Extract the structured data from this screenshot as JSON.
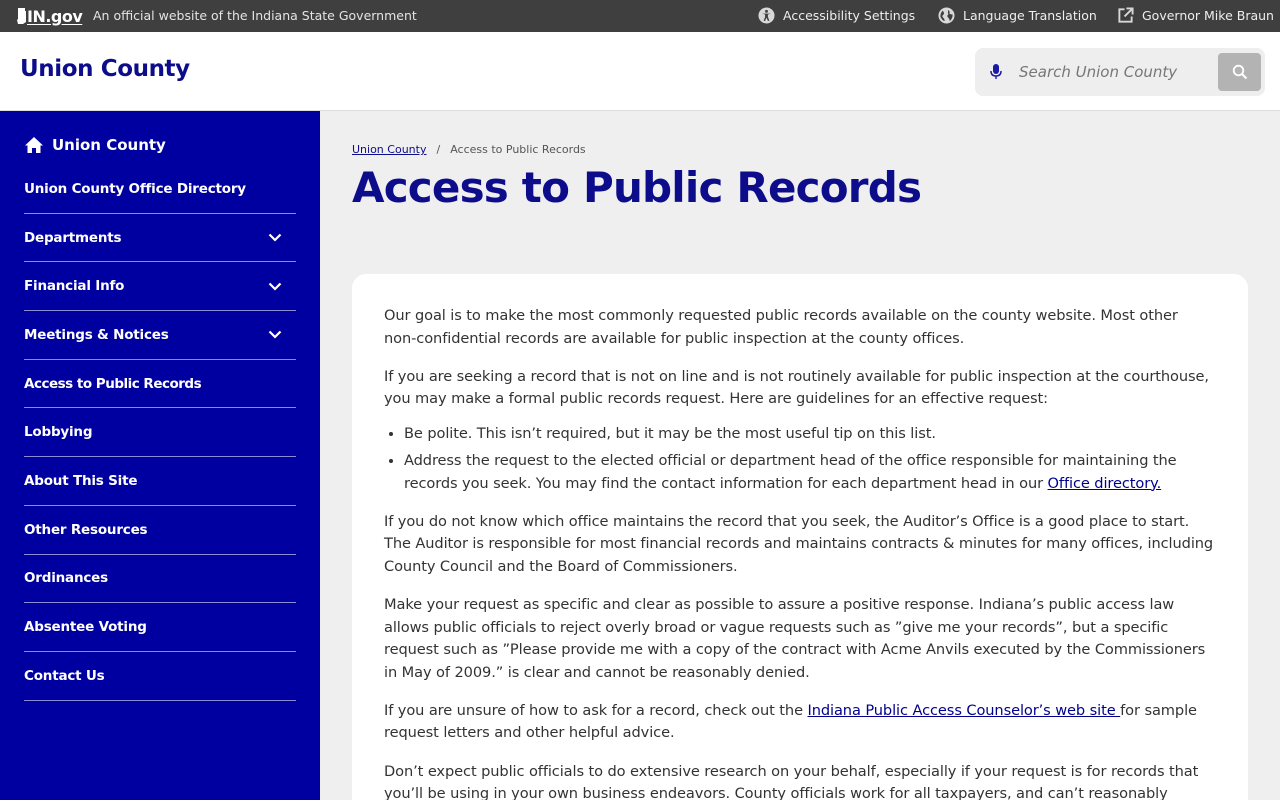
{
  "statebar": {
    "brand": "IN.gov",
    "official_text": "An official website of the Indiana State Government",
    "links": [
      {
        "label": "Accessibility Settings",
        "icon": "accessibility-icon"
      },
      {
        "label": "Language Translation",
        "icon": "globe-icon"
      },
      {
        "label": "Governor Mike Braun",
        "icon": "external-link-icon"
      }
    ]
  },
  "header": {
    "site_title": "Union County",
    "search_placeholder": "Search Union County"
  },
  "sidebar": {
    "home_label": "Union County",
    "items": [
      {
        "label": "Union County Office Directory",
        "expandable": false
      },
      {
        "label": "Departments",
        "expandable": true
      },
      {
        "label": "Financial Info",
        "expandable": true
      },
      {
        "label": "Meetings & Notices",
        "expandable": true
      },
      {
        "label": "Access to Public Records",
        "expandable": false,
        "active": true
      },
      {
        "label": "Lobbying",
        "expandable": false
      },
      {
        "label": "About This Site",
        "expandable": false
      },
      {
        "label": "Other Resources",
        "expandable": false
      },
      {
        "label": "Ordinances",
        "expandable": false
      },
      {
        "label": "Absentee Voting",
        "expandable": false
      },
      {
        "label": "Contact Us",
        "expandable": false
      }
    ]
  },
  "breadcrumb": {
    "home": "Union County",
    "separator": "/",
    "current": "Access to Public Records"
  },
  "page_title": "Access to Public Records",
  "content": {
    "p1": "Our goal is to make the most commonly requested public records available on the county website. Most other non-confidential records are available for public inspection at the county offices.",
    "p2": "If you are seeking a record that is not on line and is not routinely available for public inspection at the courthouse, you may make a formal public records request. Here are guidelines for an effective request:",
    "bullet1": "Be polite. This isn’t required, but it may be the most useful tip on this list.",
    "bullet2_pre": "Address the request to the elected official or department head of the office responsible for maintaining the records you seek. You may find the contact information for each department head in our ",
    "bullet2_link": "Office directory.",
    "p3": "If you do not know which office maintains the record that you seek, the Auditor’s Office is a good place to start. The Auditor is responsible for most financial records and maintains contracts & minutes for many offices, including County Council and the Board of Commissioners.",
    "p4": "Make your request as specific and clear as possible to assure a positive response. Indiana’s public access law allows public officials to reject overly broad or vague requests such as ”give me your records”, but a specific request such as ”Please provide me with a copy of the contract with Acme Anvils executed by the Commissioners in May of 2009.” is clear and cannot be reasonably denied.",
    "p5_pre": "If you are unsure of how to ask for a record, check out the ",
    "p5_link": "Indiana Public Access Counselor’s web site ",
    "p5_post": "for sample request letters and other helpful advice.",
    "p6": "Don’t expect public officials to do extensive research on your behalf, especially if your request is for records that you’ll be using in your own business endeavors. County officials work for all taxpayers, and can’t reasonably"
  },
  "colors": {
    "brand_navy": "#0d0d8c",
    "sidebar_blue": "#0000a0",
    "statebar_gray": "#3f3f3f"
  }
}
